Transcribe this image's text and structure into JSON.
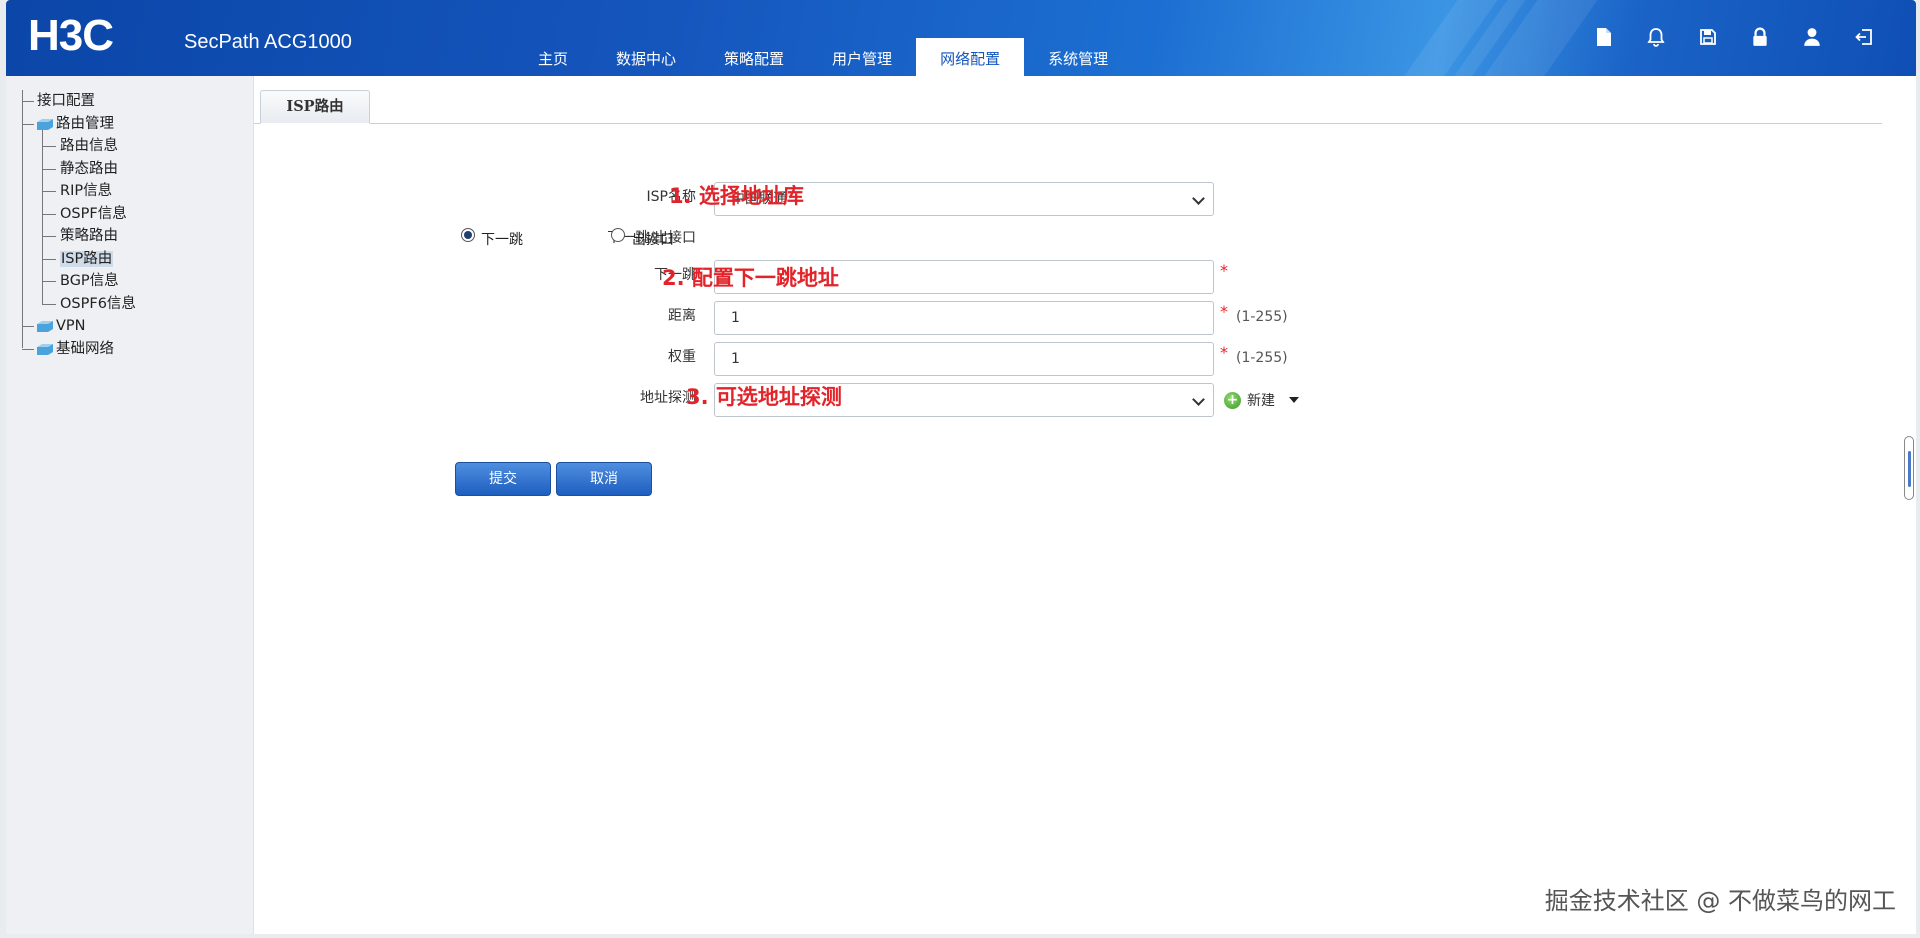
{
  "header": {
    "logo": "H3C",
    "product": "SecPath ACG1000",
    "nav": [
      "主页",
      "数据中心",
      "策略配置",
      "用户管理",
      "网络配置",
      "系统管理"
    ],
    "active_nav": "网络配置",
    "tools": [
      "document-icon",
      "bell-icon",
      "save-icon",
      "lock-icon",
      "user-icon",
      "logout-icon"
    ]
  },
  "sidebar": {
    "items": [
      {
        "label": "接口配置",
        "level": 1
      },
      {
        "label": "路由管理",
        "level": 1,
        "folder": true
      },
      {
        "label": "路由信息",
        "level": 2
      },
      {
        "label": "静态路由",
        "level": 2
      },
      {
        "label": "RIP信息",
        "level": 2
      },
      {
        "label": "OSPF信息",
        "level": 2
      },
      {
        "label": "策略路由",
        "level": 2
      },
      {
        "label": "ISP路由",
        "level": 2,
        "selected": true
      },
      {
        "label": "BGP信息",
        "level": 2
      },
      {
        "label": "OSPF6信息",
        "level": 2
      },
      {
        "label": "VPN",
        "level": 1,
        "folder": true
      },
      {
        "label": "基础网络",
        "level": 1,
        "folder": true
      }
    ]
  },
  "tab": {
    "label": "ISP路由"
  },
  "form": {
    "isp_name_label": "ISP名称",
    "isp_name_value": "中国联通",
    "nexthop_iface_label": "下一跳/出接口",
    "radio_nexthop": "下一跳",
    "radio_iface": "出接口",
    "nexthop_label": "下一跳",
    "nexthop_value": "",
    "distance_label": "距离",
    "distance_value": "1",
    "distance_range": "(1-255)",
    "weight_label": "权重",
    "weight_value": "1",
    "weight_range": "(1-255)",
    "probe_label": "地址探测",
    "probe_value": "--",
    "new_label": "新建",
    "required_mark": "*",
    "submit": "提交",
    "cancel": "取消"
  },
  "annotations": {
    "a1": "1. 选择地址库",
    "a2": "2. 配置下一跳地址",
    "a3": "3. 可选地址探测"
  },
  "watermark": "掘金技术社区 @ 不做菜鸟的网工",
  "colors": {
    "header_blue": "#1556bd",
    "annotation_red": "#e2242a",
    "button_blue": "#1e5fc0"
  }
}
